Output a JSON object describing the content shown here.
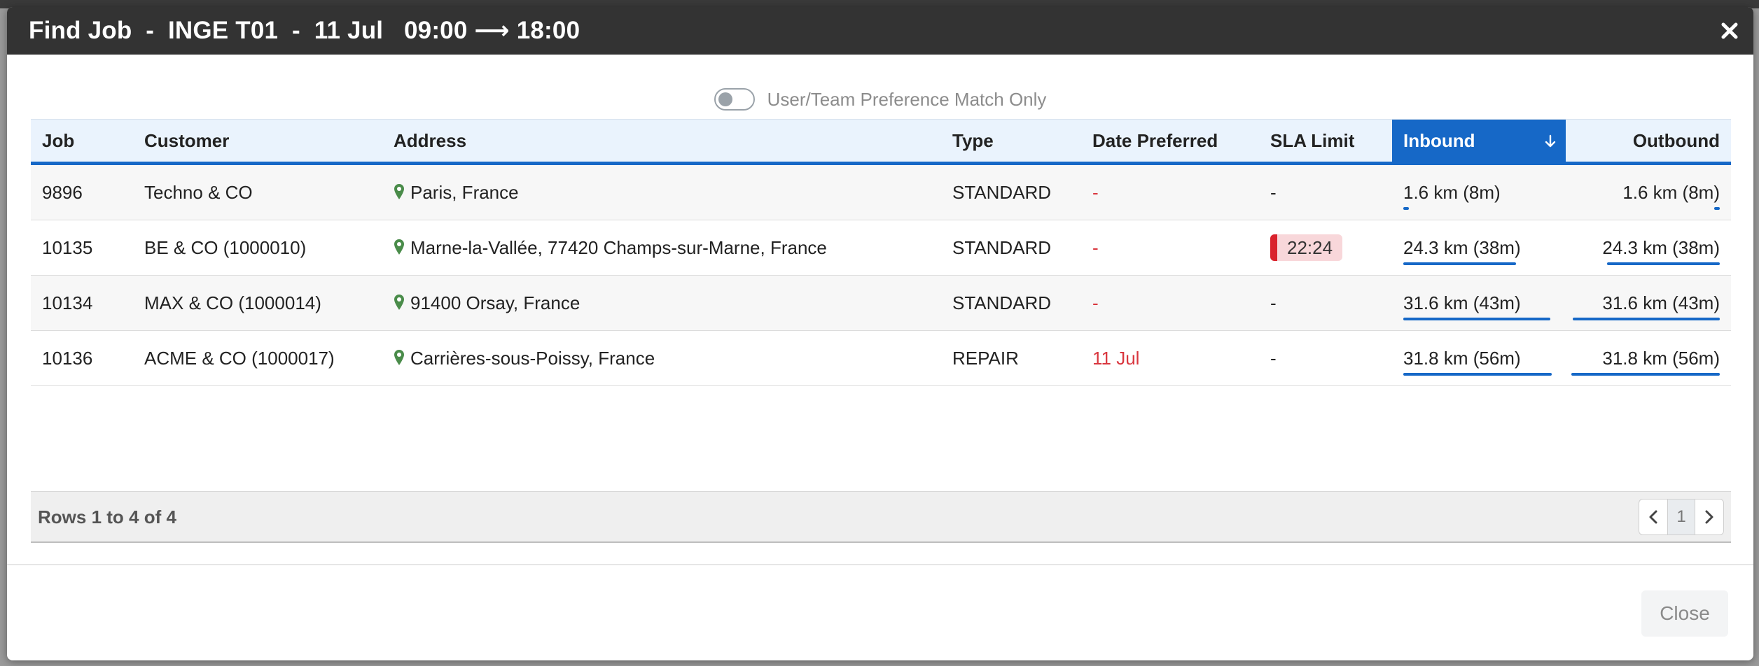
{
  "modal": {
    "title": "Find Job  -  INGE T01  -  11 Jul   09:00 ⟶ 18:00",
    "close_label": "Close"
  },
  "toggle": {
    "label": "User/Team Preference Match Only",
    "checked": false
  },
  "table": {
    "headers": {
      "job": "Job",
      "customer": "Customer",
      "address": "Address",
      "type": "Type",
      "date_preferred": "Date Preferred",
      "sla_limit": "SLA Limit",
      "inbound": "Inbound",
      "outbound": "Outbound"
    },
    "sorted_column": "inbound",
    "sort_direction": "descending-arrow",
    "rows": [
      {
        "job": "9896",
        "customer": "Techno & CO",
        "address": "Paris, France",
        "type": "STANDARD",
        "date_preferred": "-",
        "sla_limit": "-",
        "inbound": "1.6 km (8m)",
        "inbound_fraction": 0.04,
        "outbound": "1.6 km (8m)",
        "outbound_fraction": 0.04
      },
      {
        "job": "10135",
        "customer": "BE & CO (1000010)",
        "address": "Marne-la-Vallée, 77420 Champs-sur-Marne, France",
        "type": "STANDARD",
        "date_preferred": "-",
        "sla_limit": "22:24",
        "inbound": "24.3 km (38m)",
        "inbound_fraction": 0.76,
        "outbound": "24.3 km (38m)",
        "outbound_fraction": 0.76
      },
      {
        "job": "10134",
        "customer": "MAX & CO (1000014)",
        "address": "91400 Orsay, France",
        "type": "STANDARD",
        "date_preferred": "-",
        "sla_limit": "-",
        "inbound": "31.6 km (43m)",
        "inbound_fraction": 0.99,
        "outbound": "31.6 km (43m)",
        "outbound_fraction": 0.99
      },
      {
        "job": "10136",
        "customer": "ACME & CO (1000017)",
        "address": "Carrières-sous-Poissy, France",
        "type": "REPAIR",
        "date_preferred": "11 Jul",
        "sla_limit": "-",
        "inbound": "31.8 km (56m)",
        "inbound_fraction": 1.0,
        "outbound": "31.8 km (56m)",
        "outbound_fraction": 1.0
      }
    ]
  },
  "pagination": {
    "summary": "Rows 1 to 4 of 4",
    "current_page": "1"
  },
  "colors": {
    "header_bg": "#333333",
    "accent": "#1668c7",
    "danger": "#d9363e",
    "pin": "#4a8c4a",
    "sla_badge_bg": "#f8d7da"
  },
  "icons": {
    "close": "close-icon",
    "location": "map-pin-icon",
    "sort": "arrow-down-icon",
    "prev": "chevron-left-icon",
    "next": "chevron-right-icon"
  }
}
